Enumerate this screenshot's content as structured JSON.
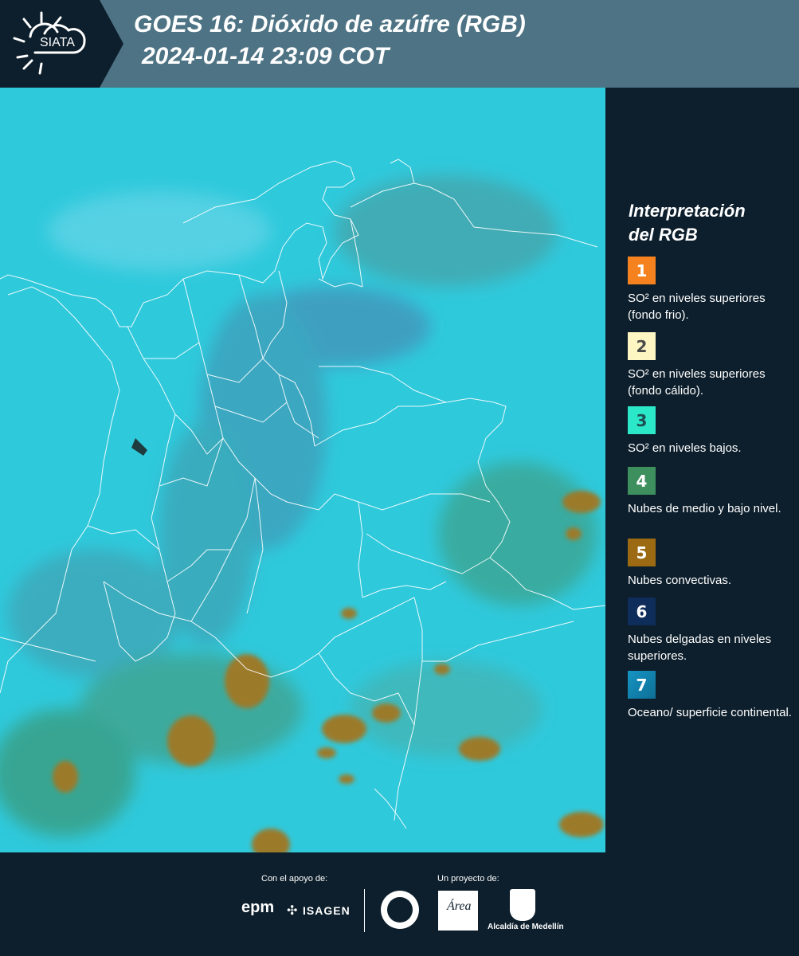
{
  "header": {
    "logo_text": "SIATA",
    "title_line1": "GOES 16: Dióxido de azúfre (RGB)",
    "title_line2": "2024-01-14 23:09 COT"
  },
  "legend": {
    "title_line1": "Interpretación",
    "title_line2": "del RGB",
    "items": [
      {
        "num": "1",
        "color": "#f5821f",
        "text": "SO² en niveles superiores (fondo frio)."
      },
      {
        "num": "2",
        "color": "#fdf6c3",
        "text": "SO² en niveles superiores (fondo cálido)."
      },
      {
        "num": "3",
        "color": "#2be8c8",
        "text": "SO² en niveles bajos."
      },
      {
        "num": "4",
        "color": "#3e8f5e",
        "text": "Nubes de medio y bajo nivel."
      },
      {
        "num": "5",
        "color": "#9b6a12",
        "text": "Nubes convectivas."
      },
      {
        "num": "6",
        "color": "#0f2d5a",
        "text": "Nubes delgadas en niveles superiores."
      },
      {
        "num": "7",
        "color": "#1594c4",
        "text": "Oceano/ superficie continental."
      }
    ]
  },
  "footer": {
    "support_label": "Con el apoyo de:",
    "project_label": "Un proyecto de:",
    "sponsor1": "epm",
    "sponsor2": "ISAGEN",
    "partner2": "Área",
    "partner3": "Alcaldía de Medellín"
  }
}
